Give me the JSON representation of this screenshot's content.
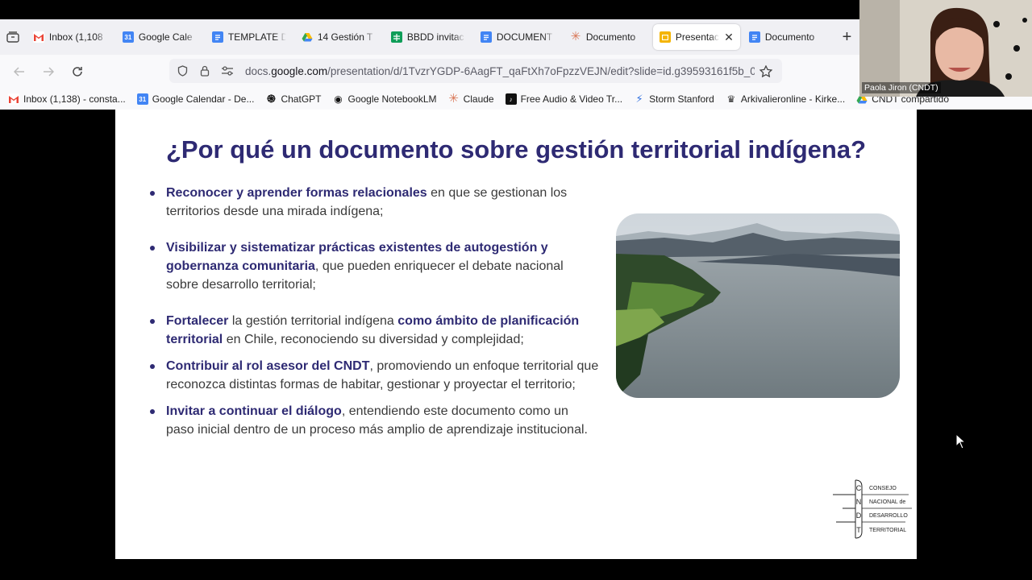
{
  "browser": {
    "tabs": [
      {
        "title": "Inbox (1,108",
        "favicon": "gmail-icon",
        "active": false
      },
      {
        "title": "Google Cale",
        "favicon": "calendar-icon",
        "active": false
      },
      {
        "title": "TEMPLATE D",
        "favicon": "docs-icon",
        "active": false
      },
      {
        "title": "14 Gestión T",
        "favicon": "drive-icon",
        "active": false
      },
      {
        "title": "BBDD invitac",
        "favicon": "sheets-icon",
        "active": false
      },
      {
        "title": "DOCUMENT",
        "favicon": "docs-icon",
        "active": false
      },
      {
        "title": "Documento",
        "favicon": "claude-icon",
        "active": false
      },
      {
        "title": "Presentac",
        "favicon": "slides-icon",
        "active": true
      },
      {
        "title": "Documento",
        "favicon": "docs-icon",
        "active": false
      }
    ],
    "url_prefix": "docs.",
    "url_domain": "google.com",
    "url_path": "/presentation/d/1TvzrYGDP-6AagFT_qaFtXh7oFpzzVEJN/edit?slide=id.g39593161f5b_0",
    "bookmarks": [
      {
        "label": "Inbox (1,138) - consta...",
        "icon": "gmail-icon"
      },
      {
        "label": "Google Calendar - De...",
        "icon": "calendar-icon"
      },
      {
        "label": "ChatGPT",
        "icon": "chatgpt-icon"
      },
      {
        "label": "Google NotebookLM",
        "icon": "notebooklm-icon"
      },
      {
        "label": "Claude",
        "icon": "claude-icon"
      },
      {
        "label": "Free Audio & Video Tr...",
        "icon": "audio-icon"
      },
      {
        "label": "Storm Stanford",
        "icon": "bolt-icon"
      },
      {
        "label": "Arkivalieronline - Kirke...",
        "icon": "crown-icon"
      },
      {
        "label": "CNDT compartido",
        "icon": "drive-icon"
      }
    ]
  },
  "slide": {
    "title": "¿Por qué un documento sobre gestión territorial indígena?",
    "bullets": [
      {
        "b1": "Reconocer y aprender formas relacionales",
        "t1": " en que se gestionan los territorios desde una mirada indígena;",
        "b2": "",
        "t2": ""
      },
      {
        "b1": "Visibilizar y sistematizar prácticas existentes de autogestión y gobernanza comunitaria",
        "t1": ", que pueden enriquecer el debate nacional sobre desarrollo territorial;",
        "b2": "",
        "t2": ""
      },
      {
        "b1": "Fortalecer",
        "t1": " la gestión territorial indígena ",
        "b2": "como ámbito de planificación territorial",
        "t2": " en Chile, reconociendo su diversidad y complejidad;"
      },
      {
        "b1": "Contribuir al rol asesor del CNDT",
        "t1": ", promoviendo un enfoque territorial que reconozca distintas formas de habitar, gestionar y proyectar el territorio;",
        "b2": "",
        "t2": ""
      },
      {
        "b1": "Invitar a continuar el diálogo",
        "t1": ", entendiendo este documento como un paso inicial dentro de un proceso más amplio de aprendizaje institucional.",
        "b2": "",
        "t2": ""
      }
    ],
    "logo": {
      "letters": [
        "C",
        "N",
        "D",
        "T"
      ],
      "words": [
        "CONSEJO",
        "NACIONAL de",
        "DESARROLLO",
        "TERRITORIAL"
      ]
    }
  },
  "webcam": {
    "name": "Paola Jiron (CNDT)"
  },
  "colors": {
    "accent": "#2e2a73",
    "tab_bg": "#f0f0f4",
    "toolbar_bg": "#f9f9fb"
  }
}
